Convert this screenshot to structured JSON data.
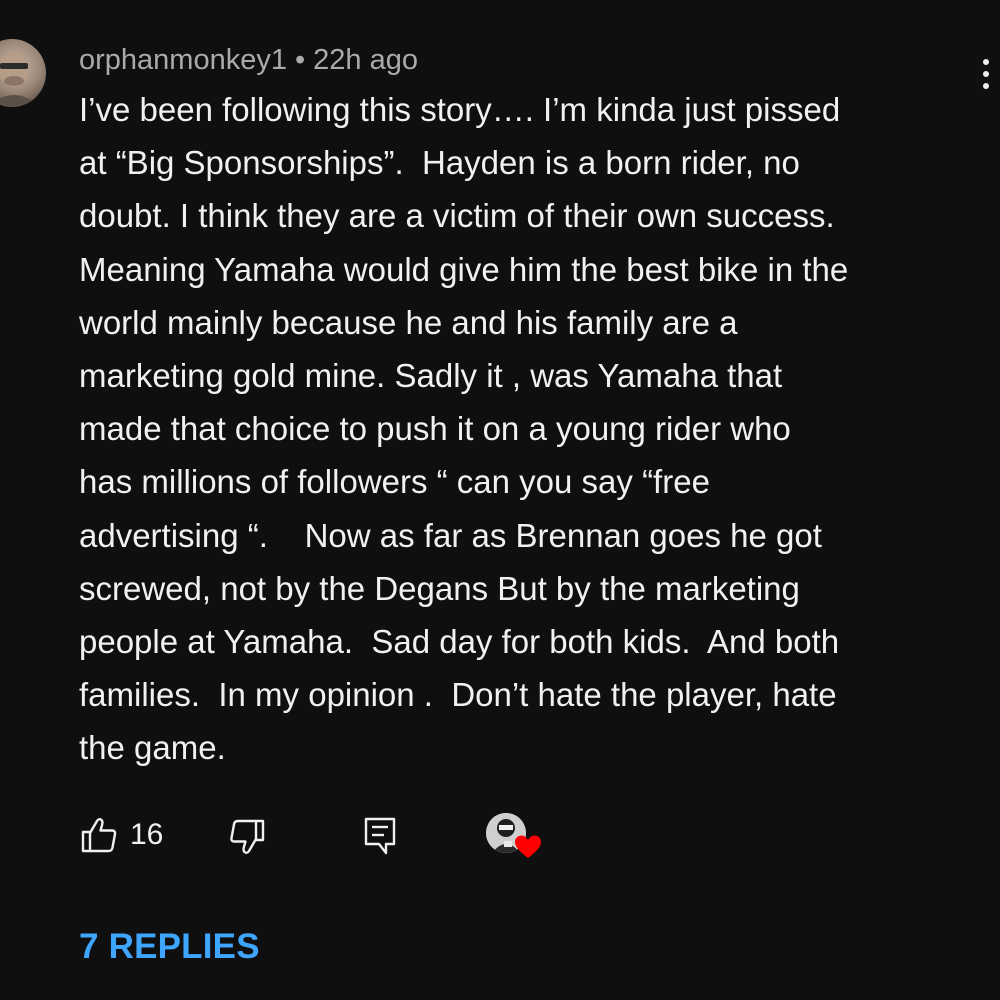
{
  "comment": {
    "author": "orphanmonkey1",
    "separator": "•",
    "time_ago": "22h ago",
    "body_lines": [
      "I’ve been following this story…. I’m kinda just pissed",
      "at “Big Sponsorships”.  Hayden is a born rider, no",
      "doubt. I think they are a victim of their own success.",
      "Meaning Yamaha would give him the best bike in the",
      "world mainly because he and his family are a",
      "marketing gold mine. Sadly it , was Yamaha that",
      "made that choice to push it on a young rider who",
      "has millions of followers “ can you say “free",
      "advertising “.    Now as far as Brennan goes he got",
      "screwed, not by the Degans But by the marketing",
      "people at Yamaha.  Sad day for both kids.  And both",
      "families.  In my opinion .  Don’t hate the player, hate",
      "the game."
    ],
    "like_count": "16",
    "replies_label": "7 REPLIES"
  },
  "icons": {
    "avatar": "user-avatar",
    "more": "vertical-ellipsis-icon",
    "like": "thumbs-up-icon",
    "dislike": "thumbs-down-icon",
    "reply": "reply-comment-icon",
    "creator": "creator-avatar",
    "heart": "heart-icon"
  },
  "colors": {
    "background": "#0f0f0f",
    "text": "#f1f1f1",
    "meta_text": "#aaaaaa",
    "replies_link": "#3ea6ff",
    "heart": "#ff0000"
  }
}
